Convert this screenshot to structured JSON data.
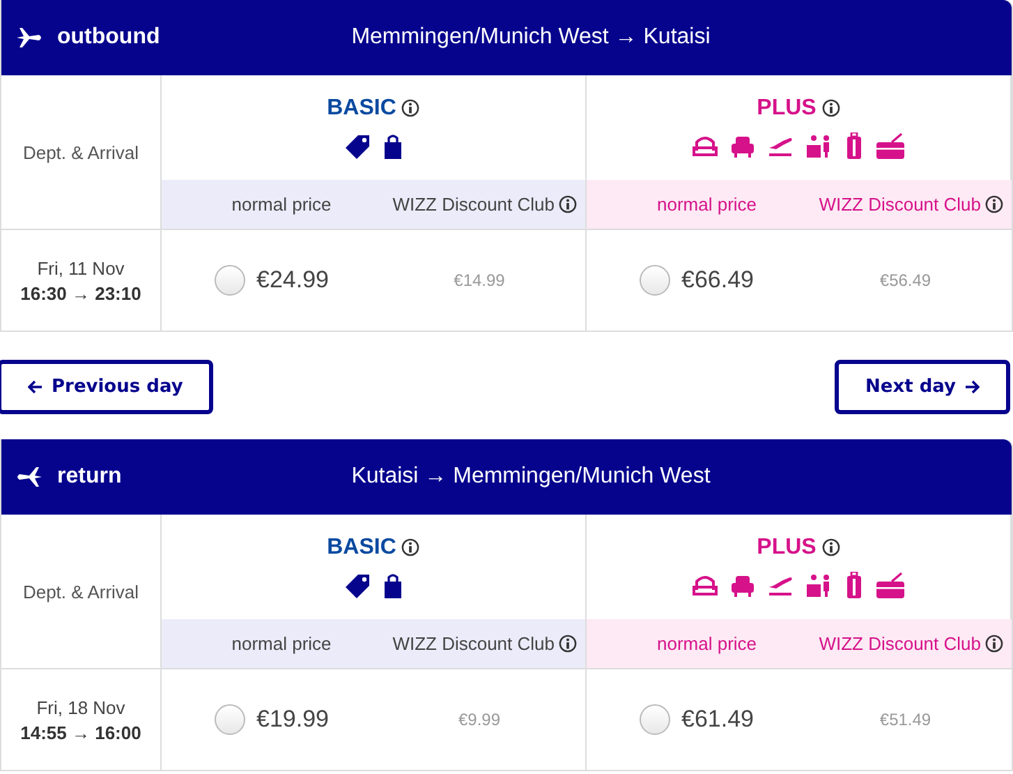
{
  "flights": [
    {
      "kind": "outbound",
      "direction": "outbound",
      "route": "Memmingen/Munich West → Kutaisi",
      "column_label": "Dept. & Arrival",
      "fares": [
        {
          "kind": "basic",
          "name": "BASIC",
          "normal_label": "normal price",
          "club_label": "WIZZ Discount Club"
        },
        {
          "kind": "plus",
          "name": "PLUS",
          "normal_label": "normal price",
          "club_label": "WIZZ Discount Club"
        }
      ],
      "rows": [
        {
          "date": "Fri, 11 Nov",
          "times": "16:30 → 23:10",
          "prices": [
            {
              "price": "€24.99",
              "club_price": "€14.99",
              "selected": false
            },
            {
              "price": "€66.49",
              "club_price": "€56.49",
              "selected": false
            }
          ]
        }
      ]
    },
    {
      "kind": "return",
      "direction": "return",
      "route": "Kutaisi → Memmingen/Munich West",
      "column_label": "Dept. & Arrival",
      "fares": [
        {
          "kind": "basic",
          "name": "BASIC",
          "normal_label": "normal price",
          "club_label": "WIZZ Discount Club"
        },
        {
          "kind": "plus",
          "name": "PLUS",
          "normal_label": "normal price",
          "club_label": "WIZZ Discount Club"
        }
      ],
      "rows": [
        {
          "date": "Fri, 18 Nov",
          "times": "14:55 → 16:00",
          "prices": [
            {
              "price": "€19.99",
              "club_price": "€9.99",
              "selected": false
            },
            {
              "price": "€61.49",
              "club_price": "€51.49",
              "selected": false
            }
          ]
        }
      ]
    }
  ],
  "navigation": {
    "previous": "Previous day",
    "next": "Next day"
  }
}
